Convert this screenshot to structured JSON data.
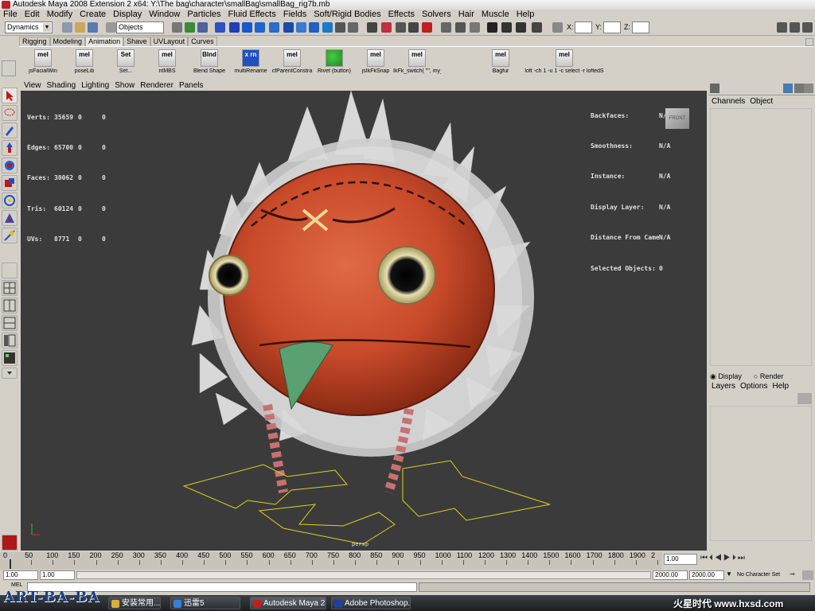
{
  "window": {
    "title": "Autodesk Maya 2008 Extension 2 x64: Y:\\The bag\\character\\smallBag\\smallBag_rig7b.mb"
  },
  "menubar": [
    "File",
    "Edit",
    "Modify",
    "Create",
    "Display",
    "Window",
    "Particles",
    "Fluid Effects",
    "Fields",
    "Soft/Rigid Bodies",
    "Effects",
    "Solvers",
    "Hair",
    "Muscle",
    "Help"
  ],
  "statusline": {
    "mode": "Dynamics",
    "selection_mask": "Objects",
    "x_label": "X:",
    "y_label": "Y:",
    "z_label": "Z:"
  },
  "shelf_tabs": [
    "Rigging",
    "Modeling",
    "Animation",
    "Shave",
    "UVLayout",
    "Curves"
  ],
  "active_shelf_tab": "Animation",
  "shelf_items": [
    {
      "icon": "mel",
      "label": "jsFacialWin"
    },
    {
      "icon": "mel",
      "label": "poseLib"
    },
    {
      "icon": "Set",
      "label": "Set..."
    },
    {
      "icon": "mel",
      "label": "ntMBS"
    },
    {
      "icon": "Blnd",
      "label": "Blend Shape"
    },
    {
      "icon": "x rn",
      "label": "multiRename"
    },
    {
      "icon": "mel",
      "label": "cfParentConstra"
    },
    {
      "icon": "",
      "label": "Rivet (button)"
    },
    {
      "icon": "mel",
      "label": "jsIkFkSnap"
    },
    {
      "icon": "mel",
      "label": "IkFk_switch( \"\", my_AnmCopyWi"
    },
    {
      "icon": "mel",
      "label": "Bagfur"
    },
    {
      "icon": "mel",
      "label": "loft -ch 1 -u 1 -c select -r loftedS"
    }
  ],
  "panel_menu": [
    "View",
    "Shading",
    "Lighting",
    "Show",
    "Renderer",
    "Panels"
  ],
  "hud_left": [
    {
      "label": "Verts:",
      "v1": "35659",
      "v2": "0",
      "v3": "0"
    },
    {
      "label": "Edges:",
      "v1": "65700",
      "v2": "0",
      "v3": "0"
    },
    {
      "label": "Faces:",
      "v1": "30062",
      "v2": "0",
      "v3": "0"
    },
    {
      "label": "Tris:",
      "v1": "60124",
      "v2": "0",
      "v3": "0"
    },
    {
      "label": "UVs:",
      "v1": "8771",
      "v2": "0",
      "v3": "0"
    }
  ],
  "hud_right": [
    {
      "label": "Backfaces:",
      "value": "N/A"
    },
    {
      "label": "Smoothness:",
      "value": "N/A"
    },
    {
      "label": "Instance:",
      "value": "N/A"
    },
    {
      "label": "Display Layer:",
      "value": "N/A"
    },
    {
      "label": "Distance From Camera:",
      "value": "N/A"
    },
    {
      "label": "Selected Objects:",
      "value": "0"
    }
  ],
  "viewcube_label": "FRONT",
  "camera_label": "persp",
  "channel_box": {
    "tabs": [
      "Channels",
      "Object"
    ]
  },
  "layer_editor": {
    "radio_display": "Display",
    "radio_render": "Render",
    "menu": [
      "Layers",
      "Options",
      "Help"
    ]
  },
  "timeline": {
    "ticks": [
      "0",
      "50",
      "100",
      "150",
      "200",
      "250",
      "300",
      "350",
      "400",
      "450",
      "500",
      "550",
      "600",
      "650",
      "700",
      "750",
      "800",
      "850",
      "900",
      "950",
      "1000",
      "1100",
      "1200",
      "1300",
      "1400",
      "1500",
      "1600",
      "1700",
      "1800",
      "1900",
      "2"
    ],
    "current_frame": "1.00"
  },
  "range": {
    "start": "1.00",
    "inner_start": "1.00",
    "inner_end": "2000.00",
    "end": "2000.00",
    "character_set": "No Character Set"
  },
  "cmdline": {
    "label": "MEL"
  },
  "taskbar": [
    {
      "label": "安装常用..."
    },
    {
      "label": "迅雷5"
    },
    {
      "label": "Autodesk Maya 2..."
    },
    {
      "label": "Adobe Photoshop..."
    }
  ],
  "watermark_left": "ART-BA-BA",
  "watermark_right": "火星时代 www.hxsd.com"
}
